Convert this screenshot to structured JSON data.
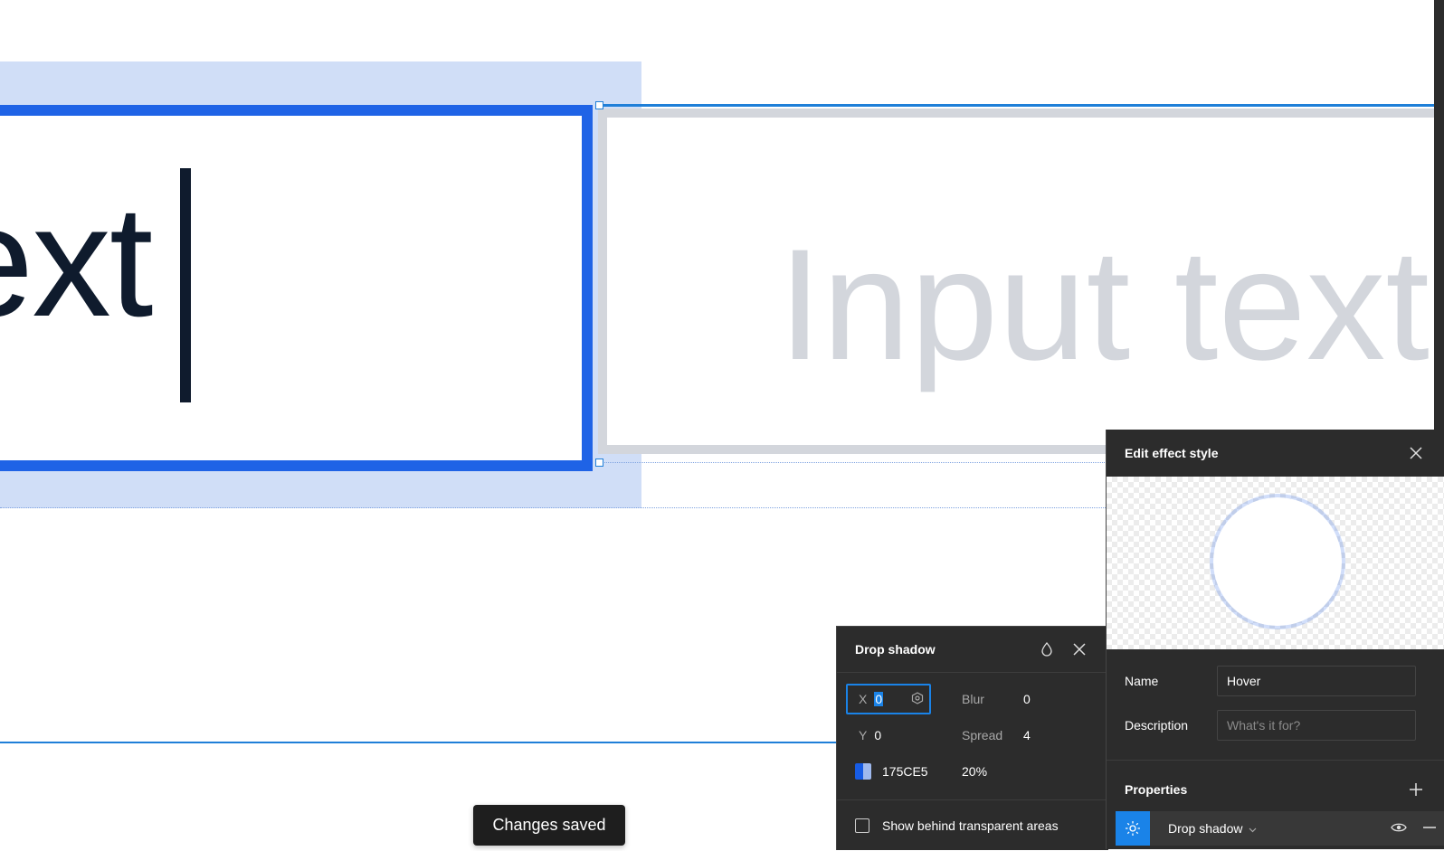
{
  "canvas": {
    "focused_text": "ext",
    "placeholder_text": "Input text"
  },
  "toast": {
    "text": "Changes saved"
  },
  "drop_shadow_panel": {
    "title": "Drop shadow",
    "x_label": "X",
    "x_value": "0",
    "y_label": "Y",
    "y_value": "0",
    "blur_label": "Blur",
    "blur_value": "0",
    "spread_label": "Spread",
    "spread_value": "4",
    "color_hex": "175CE5",
    "opacity": "20%",
    "show_behind_label": "Show behind transparent areas",
    "show_behind_checked": false,
    "icons": [
      "drop-icon",
      "close-icon",
      "ring-icon"
    ]
  },
  "effect_style_panel": {
    "title": "Edit effect style",
    "name_label": "Name",
    "name_value": "Hover",
    "description_label": "Description",
    "description_placeholder": "What's it for?",
    "properties_label": "Properties",
    "property_effect": "Drop shadow",
    "icons": [
      "close-icon",
      "add-icon",
      "sun-icon",
      "chevron-down-icon",
      "eye-icon",
      "minus-icon"
    ]
  },
  "colors": {
    "accent": "#1A83E8",
    "focus_border": "#1F63E6",
    "shadow_color": "#175CE5",
    "panel_bg": "#2C2C2C"
  }
}
